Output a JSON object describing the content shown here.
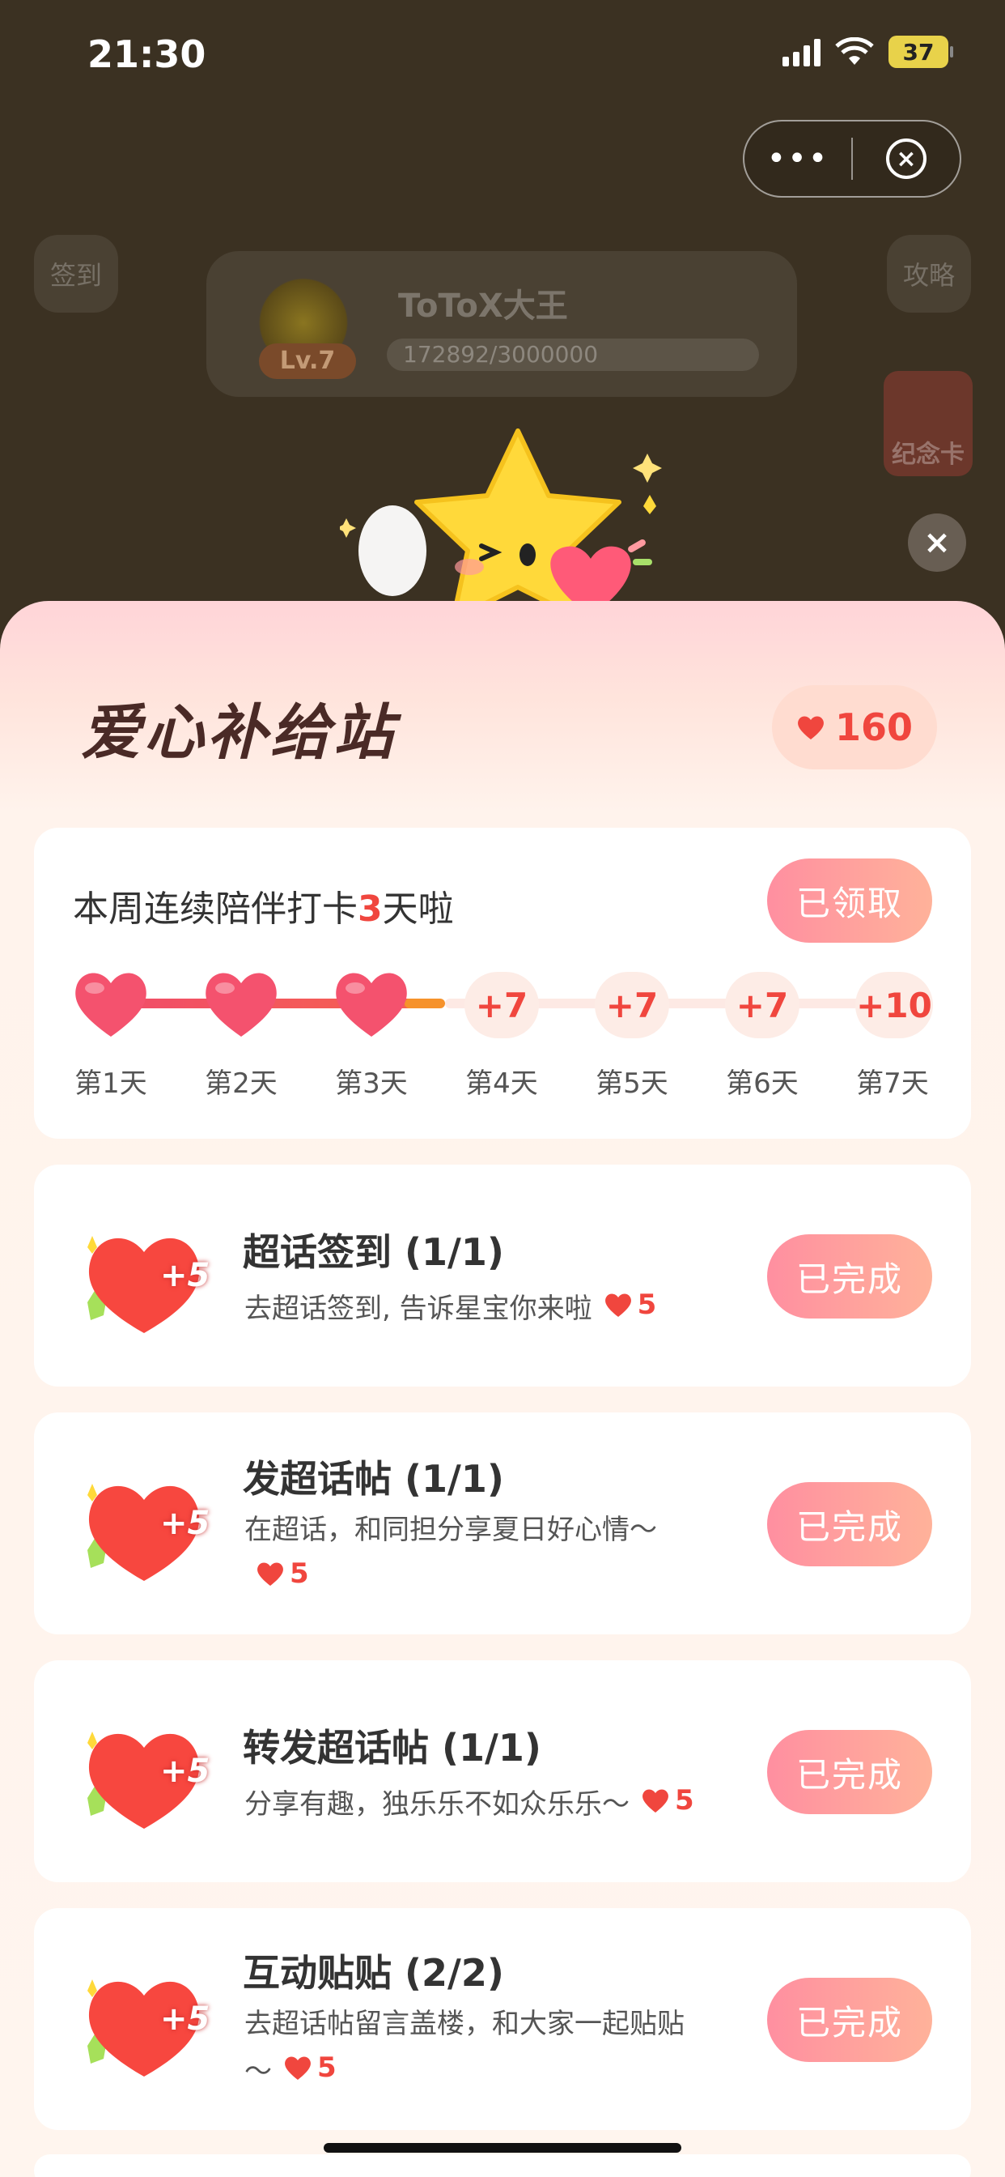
{
  "status_bar": {
    "time": "21:30",
    "battery": "37"
  },
  "capsule": {
    "more": "•••",
    "close": "×"
  },
  "background": {
    "left_chip": "签到",
    "right_chip": "攻略",
    "level": "Lv.7",
    "name": "ToToX大王",
    "progress": "172892/3000000",
    "card": "纪念卡"
  },
  "modal": {
    "close": "×",
    "title": "爱心补给站",
    "heart_count": "160"
  },
  "streak": {
    "text_prefix": "本周连续陪伴打卡",
    "days": "3",
    "text_suffix": "天啦",
    "button": "已领取",
    "day_labels": [
      "第1天",
      "第2天",
      "第3天",
      "第4天",
      "第5天",
      "第6天",
      "第7天"
    ],
    "future_rewards": [
      "+7",
      "+7",
      "+7",
      "+10"
    ]
  },
  "tasks": [
    {
      "title": "超话签到 (1/1)",
      "desc": "去超话签到, 告诉星宝你来啦",
      "reward": "5",
      "badge": "+5",
      "button": "已完成"
    },
    {
      "title": "发超话帖 (1/1)",
      "desc": " 在超话，和同担分享夏日好心情～",
      "reward": "5",
      "badge": "+5",
      "button": "已完成"
    },
    {
      "title": "转发超话帖 (1/1)",
      "desc": "分享有趣，独乐乐不如众乐乐～",
      "reward": "5",
      "badge": "+5",
      "button": "已完成"
    },
    {
      "title": "互动贴贴 (2/2)",
      "desc": "去超话帖留言盖楼，和大家一起贴贴～",
      "reward": "5",
      "badge": "+5",
      "button": "已完成"
    }
  ],
  "colors": {
    "accent": "#f0463e",
    "pill_start": "#ff8fa0",
    "pill_end": "#ffb29a",
    "sheet_top": "#ffd4d8"
  }
}
